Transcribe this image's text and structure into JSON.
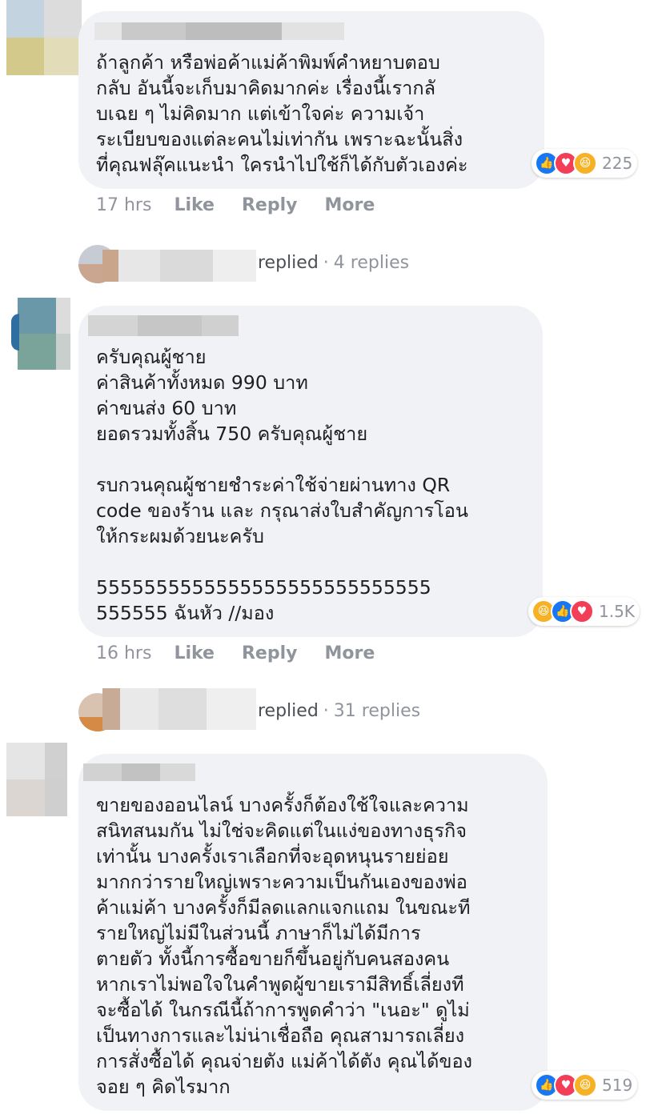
{
  "comments": [
    {
      "text": "ถ้าลูกค้า หรือพ่อค้าแม่ค้าพิมพ์คำหยาบตอบ\nกลับ อันนี้จะเก็บมาคิดมากค่ะ เรื่องนี้เรากลั\nบเฉย ๆ ไม่คิดมาก แต่เข้าใจค่ะ ความเจ้า\nระเบียบของแต่ละคนไม่เท่ากัน เพราะฉะนั้นสิ่ง\nที่คุณฟลุ๊คแนะนำ ใครนำไปใช้ก็ได้กับตัวเองค่ะ",
      "reactions": {
        "count": "225",
        "icons": [
          "like",
          "love",
          "haha"
        ]
      },
      "time": "17 hrs",
      "actions": [
        "Like",
        "Reply",
        "More"
      ],
      "replies": {
        "label": "replied",
        "count": "4 replies"
      }
    },
    {
      "text": "ครับคุณผู้ชาย\nค่าสินค้าทั้งหมด 990 บาท\nค่าขนส่ง 60 บาท\nยอดรวมทั้งสิ้น 750 ครับคุณผู้ชาย\n\nรบกวนคุณผู้ชายชำระค่าใช้จ่ายผ่านทาง QR\ncode ของร้าน และ กรุณาส่งใบสำคัญการโอน\nให้กระผมด้วยนะครับ\n\n5555555555555555555555555555\n555555 ฉันหัว //มอง",
      "reactions": {
        "count": "1.5K",
        "icons": [
          "haha",
          "like",
          "love"
        ]
      },
      "time": "16 hrs",
      "actions": [
        "Like",
        "Reply",
        "More"
      ],
      "replies": {
        "label": "replied",
        "count": "31 replies"
      }
    },
    {
      "text": "ขายของออนไลน์ บางครั้งก็ต้องใช้ใจและความ\nสนิทสนมกัน ไม่ใช่จะคิดแต่ในแง่ของทางธุรกิจ\nเท่านั้น บางครั้งเราเลือกที่จะอุดหนุนรายย่อย\nมากกว่ารายใหญ่เพราะความเป็นกันเองของพ่อ\nค้าแม่ค้า บางครั้งก็มีลดแลกแจกแถม ในขณะที\nรายใหญ่ไม่มีในส่วนนี้ ภาษาก็ไม่ได้มีการ\nตายตัว ทั้งนี้การซื้อขายก็ขึ้นอยู่กับคนสองคน\nหากเราไม่พอใจในคำพูดผู้ขายเรามีสิทธิ์เลี่ยงที\nจะซื้อได้ ในกรณีนี้ถ้าการพูดคำว่า \"เนอะ\" ดูไม่\nเป็นทางการและไม่น่าเชื่อถือ คุณสามารถเลี่ยง\nการสั่งซื้อได้ คุณจ่ายตัง แม่ค้าได้ตัง คุณได้ของ\nจอย ๆ คิดไรมาก",
      "reactions": {
        "count": "519",
        "icons": [
          "like",
          "love",
          "haha"
        ]
      }
    }
  ]
}
